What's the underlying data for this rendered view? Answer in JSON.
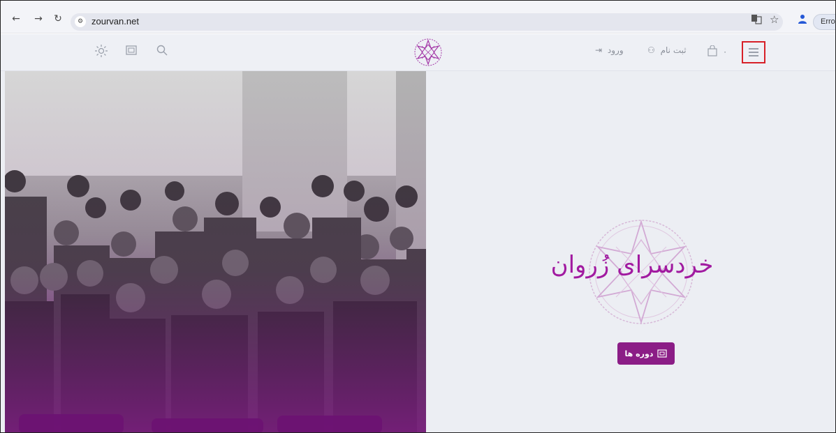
{
  "browser": {
    "url": "zourvan.net",
    "error_label": "Error"
  },
  "header": {
    "theme_icon": "sun-icon",
    "courses_icon": "book-icon",
    "search_icon": "search-icon",
    "login_label": "ورود",
    "signup_label": "ثبت نام",
    "cart_count": "۰",
    "menu_icon": "hamburger-menu-icon"
  },
  "hero": {
    "title": "خردسرای زُروان",
    "cta_label": "دوره ها"
  },
  "colors": {
    "brand": "#8b1d86",
    "title": "#a11aa0",
    "highlight": "#d72028"
  }
}
